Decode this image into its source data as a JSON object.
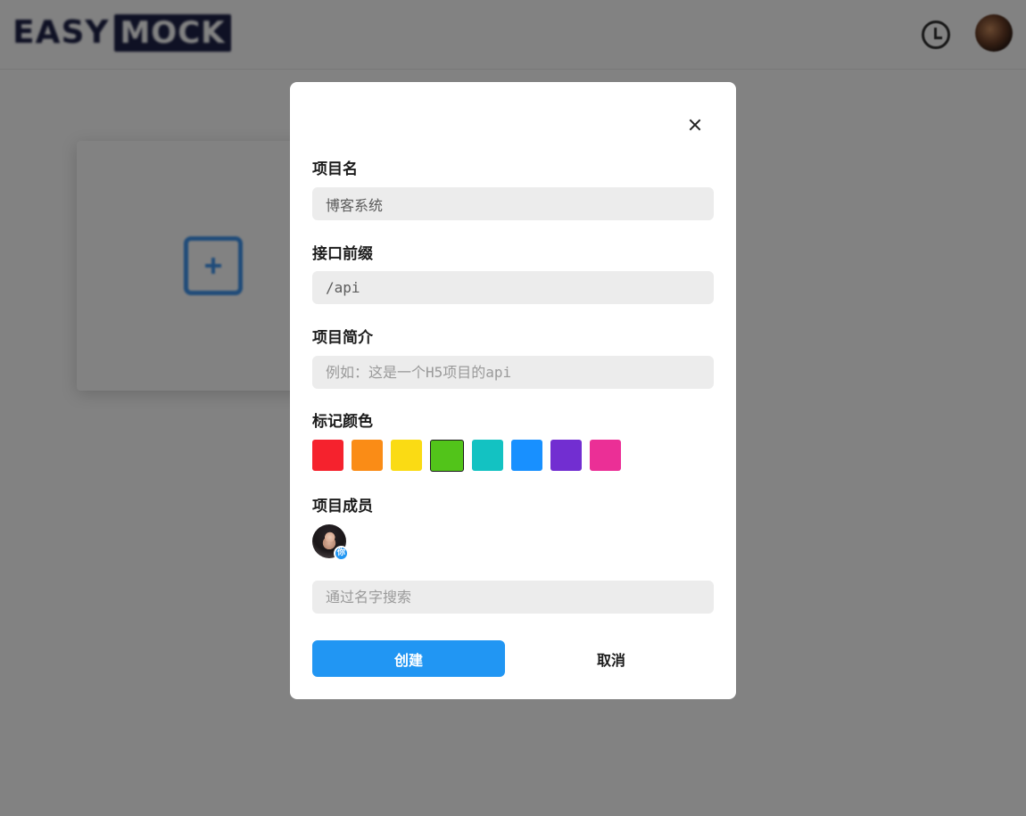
{
  "header": {
    "logo_part1": "EASY",
    "logo_part2": "MOCK",
    "history_icon": "clock-icon",
    "avatar_icon": "user-avatar"
  },
  "background": {
    "new_project_icon": "plus-square-icon"
  },
  "dialog": {
    "close_icon": "close-icon",
    "project_name": {
      "label": "项目名",
      "value": "博客系统"
    },
    "api_prefix": {
      "label": "接口前缀",
      "value": "/api"
    },
    "description": {
      "label": "项目简介",
      "placeholder": "例如：这是一个H5项目的api"
    },
    "color_tag": {
      "label": "标记颜色",
      "colors": [
        "#f5222d",
        "#fa8c16",
        "#fadb14",
        "#52c41a",
        "#13c2c2",
        "#1890ff",
        "#722ed1",
        "#eb2f96"
      ],
      "selected": "#52c41a"
    },
    "members": {
      "label": "项目成员",
      "badge": "你",
      "search_placeholder": "通过名字搜索"
    },
    "create_label": "创建",
    "cancel_label": "取消"
  }
}
